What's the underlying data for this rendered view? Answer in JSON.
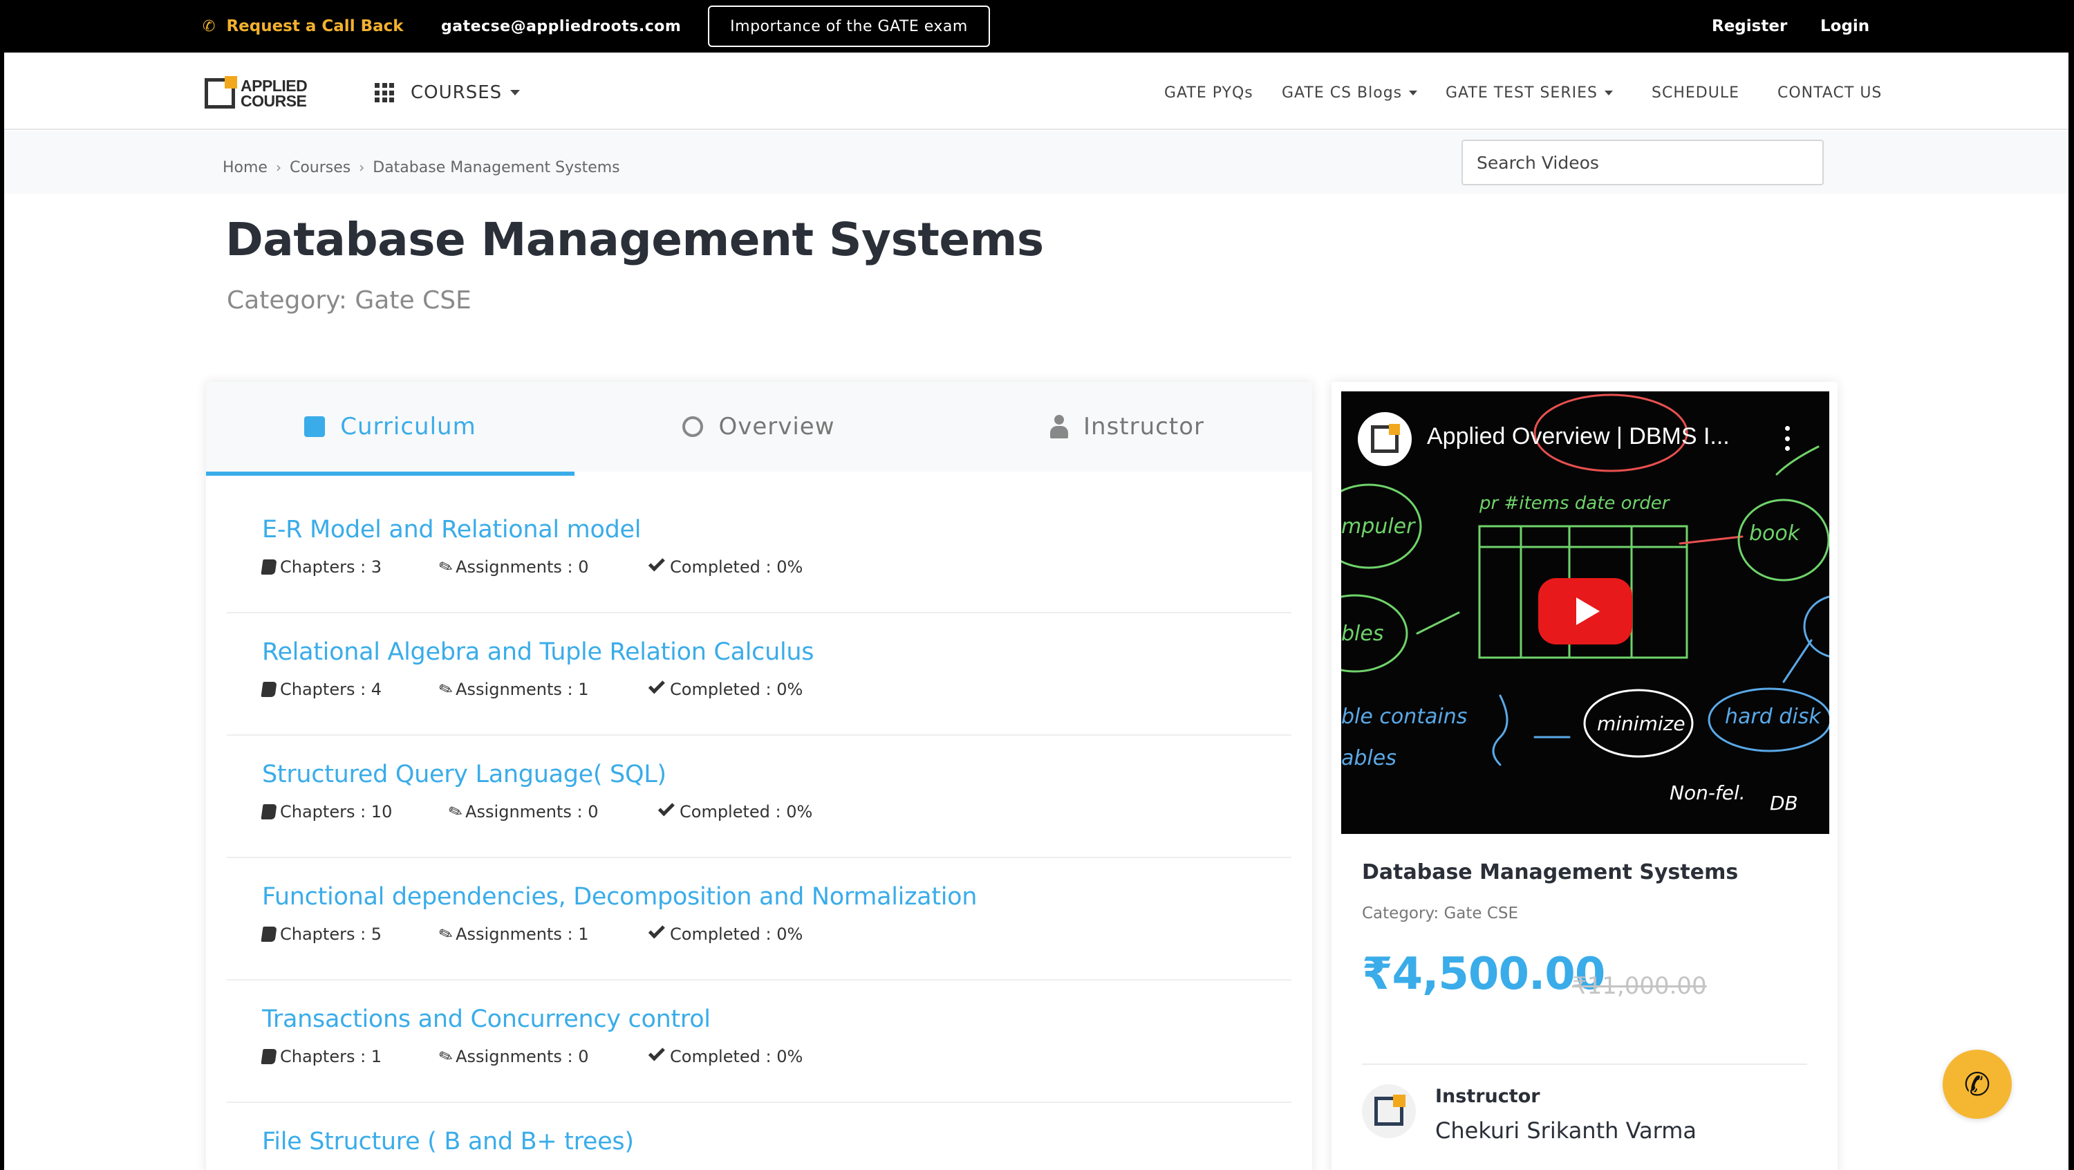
{
  "topbar": {
    "callback_icon": "phone-icon",
    "callback_label": "Request a Call Back",
    "email": "gatecse@appliedroots.com",
    "gate_button": "Importance of the GATE exam",
    "register": "Register",
    "login": "Login",
    "accent_color": "#f2b12d"
  },
  "navbar": {
    "logo_line1": "APPLIED",
    "logo_line2": "COURSE",
    "courses_label": "COURSES",
    "links": [
      {
        "label": "GATE PYQs"
      },
      {
        "label": "GATE CS Blogs"
      },
      {
        "label": "GATE TEST SERIES"
      },
      {
        "label": "SCHEDULE"
      },
      {
        "label": "CONTACT US"
      }
    ]
  },
  "breadcrumb": [
    "Home",
    "Courses",
    "Database Management Systems"
  ],
  "search": {
    "placeholder": "Search Videos"
  },
  "course": {
    "title": "Database Management Systems",
    "category": "Category: Gate CSE"
  },
  "tabs": [
    {
      "label": "Curriculum",
      "icon": "square-icon",
      "active": true
    },
    {
      "label": "Overview",
      "icon": "circle-icon",
      "active": false
    },
    {
      "label": "Instructor",
      "icon": "user-icon",
      "active": false
    }
  ],
  "modules": [
    {
      "title": "E-R Model and Relational model",
      "chapters": "Chapters : 3",
      "assignments": "Assignments : 0",
      "completed": "Completed : 0%"
    },
    {
      "title": "Relational Algebra and Tuple Relation Calculus",
      "chapters": "Chapters : 4",
      "assignments": "Assignments : 1",
      "completed": "Completed : 0%"
    },
    {
      "title": "Structured Query Language( SQL)",
      "chapters": "Chapters : 10",
      "assignments": "Assignments : 0",
      "completed": "Completed : 0%"
    },
    {
      "title": "Functional dependencies, Decomposition and Normalization",
      "chapters": "Chapters : 5",
      "assignments": "Assignments : 1",
      "completed": "Completed : 0%"
    },
    {
      "title": "Transactions and Concurrency control",
      "chapters": "Chapters : 1",
      "assignments": "Assignments : 0",
      "completed": "Completed : 0%"
    },
    {
      "title": "File Structure ( B and B+ trees)",
      "chapters": "",
      "assignments": "",
      "completed": ""
    }
  ],
  "sidebar": {
    "video_title": "Applied Overview | DBMS I...",
    "title": "Database Management Systems",
    "category": "Category: Gate CSE",
    "price": "₹4,500.00",
    "old_price": "₹11,000.00",
    "instructor_label": "Instructor",
    "instructor_name": "Chekuri Srikanth Varma",
    "price_color": "#3aace9"
  },
  "fab": {
    "icon": "phone-call-icon",
    "color": "#f5b731"
  }
}
